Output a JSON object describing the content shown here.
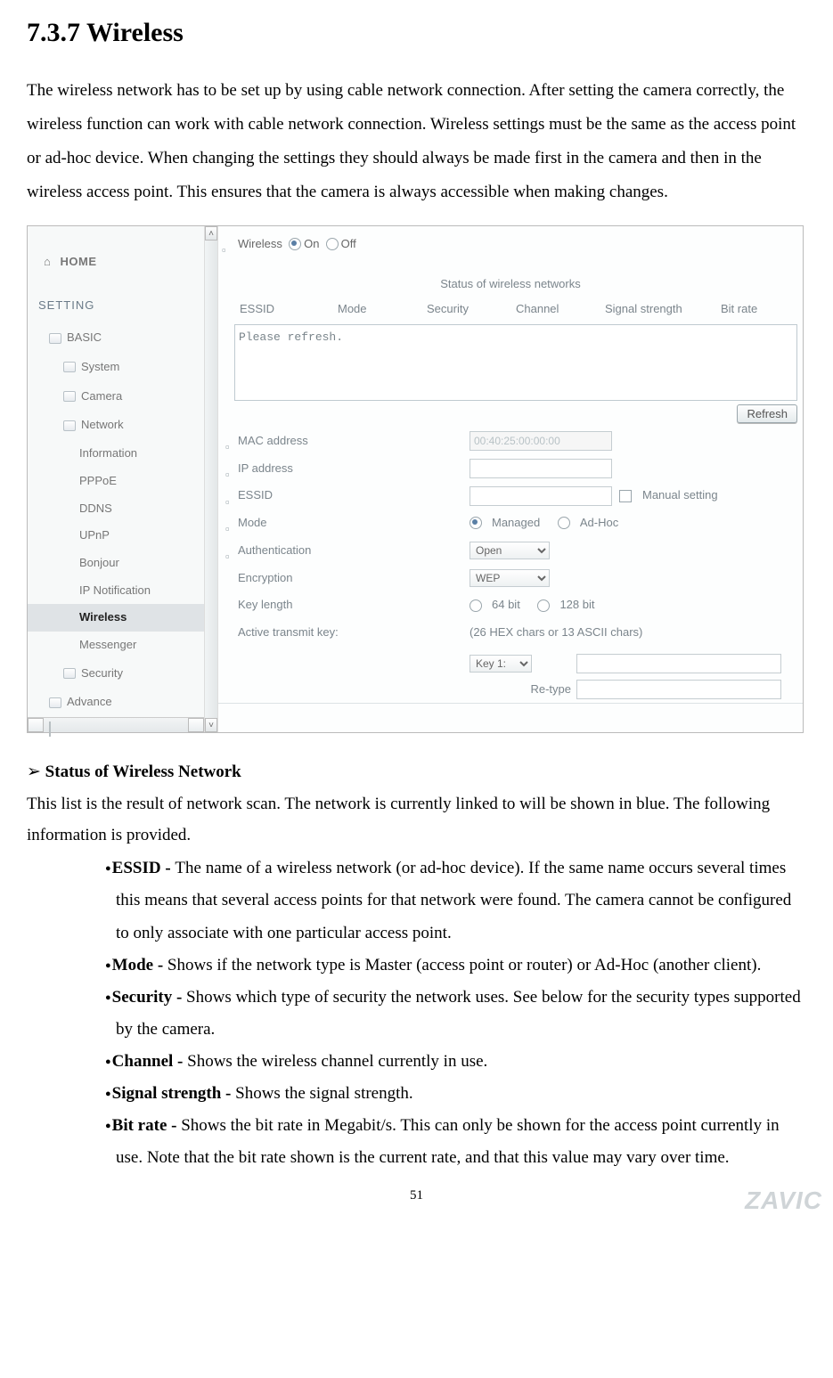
{
  "doc": {
    "section_number_title": "7.3.7 Wireless",
    "intro": "The wireless network has to be set up by using cable network connection. After setting the camera correctly, the wireless function can work with cable network connection. Wireless settings must be the same as the access point or ad-hoc device. When changing the settings they should always be made first in the camera and then in the wireless access point. This ensures that the camera is always accessible when making changes.",
    "status_heading": "Status of Wireless Network",
    "status_intro": "This list is the result of network scan. The network is currently linked to will be shown in blue. The following information is provided.",
    "bullets": {
      "essid": {
        "term": "ESSID - ",
        "text": "The name of a wireless network (or ad-hoc device). If the same name occurs several times this means that several access points for that network were found. The camera cannot be configured to only associate with one particular access point."
      },
      "mode": {
        "term": "Mode - ",
        "text": "Shows if the network type is Master (access point or router) or Ad-Hoc (another client)."
      },
      "security": {
        "term": "Security - ",
        "text": "Shows which type of security the network uses. See below for the security types supported by the camera."
      },
      "channel": {
        "term": "Channel - ",
        "text": "Shows the wireless channel currently in use."
      },
      "signal": {
        "term": "Signal strength - ",
        "text": "Shows the signal strength."
      },
      "bitrate": {
        "term": "Bit rate - ",
        "text": "Shows the bit rate in Megabit/s. This can only be shown for the access point currently in use. Note that the bit rate shown is the current rate, and that this value may vary over time."
      }
    },
    "page_number": "51",
    "brand": "ZAVIC"
  },
  "ui": {
    "sidebar": {
      "home": "HOME",
      "setting": "SETTING",
      "basic": "BASIC",
      "basic_children": {
        "system": "System",
        "camera": "Camera",
        "network": "Network",
        "network_children": {
          "information": "Information",
          "pppoe": "PPPoE",
          "ddns": "DDNS",
          "upnp": "UPnP",
          "bonjour": "Bonjour",
          "ipnotif": "IP Notification",
          "wireless": "Wireless",
          "messenger": "Messenger"
        },
        "security": "Security"
      },
      "advance": "Advance"
    },
    "main": {
      "wireless_label": "Wireless",
      "on": "On",
      "off": "Off",
      "status_title": "Status of wireless networks",
      "cols": {
        "essid": "ESSID",
        "mode": "Mode",
        "security": "Security",
        "channel": "Channel",
        "signal": "Signal strength",
        "bitrate": "Bit rate"
      },
      "list_placeholder": "Please refresh.",
      "refresh": "Refresh",
      "fields": {
        "mac": {
          "label": "MAC address",
          "value": "00:40:25:00:00:00"
        },
        "ip": {
          "label": "IP address",
          "value": ""
        },
        "essid": {
          "label": "ESSID",
          "value": "",
          "manual": "Manual setting"
        },
        "mode": {
          "label": "Mode",
          "managed": "Managed",
          "adhoc": "Ad-Hoc"
        },
        "auth": {
          "label": "Authentication",
          "value": "Open"
        },
        "enc": {
          "label": "Encryption",
          "value": "WEP"
        },
        "keylen": {
          "label": "Key length",
          "k64": "64 bit",
          "k128": "128 bit"
        },
        "active": {
          "label": "Active transmit key:",
          "note": "(26 HEX chars or 13 ASCII chars)"
        },
        "key1": {
          "label": "Key 1:"
        },
        "retype": {
          "label": "Re-type"
        }
      }
    }
  }
}
